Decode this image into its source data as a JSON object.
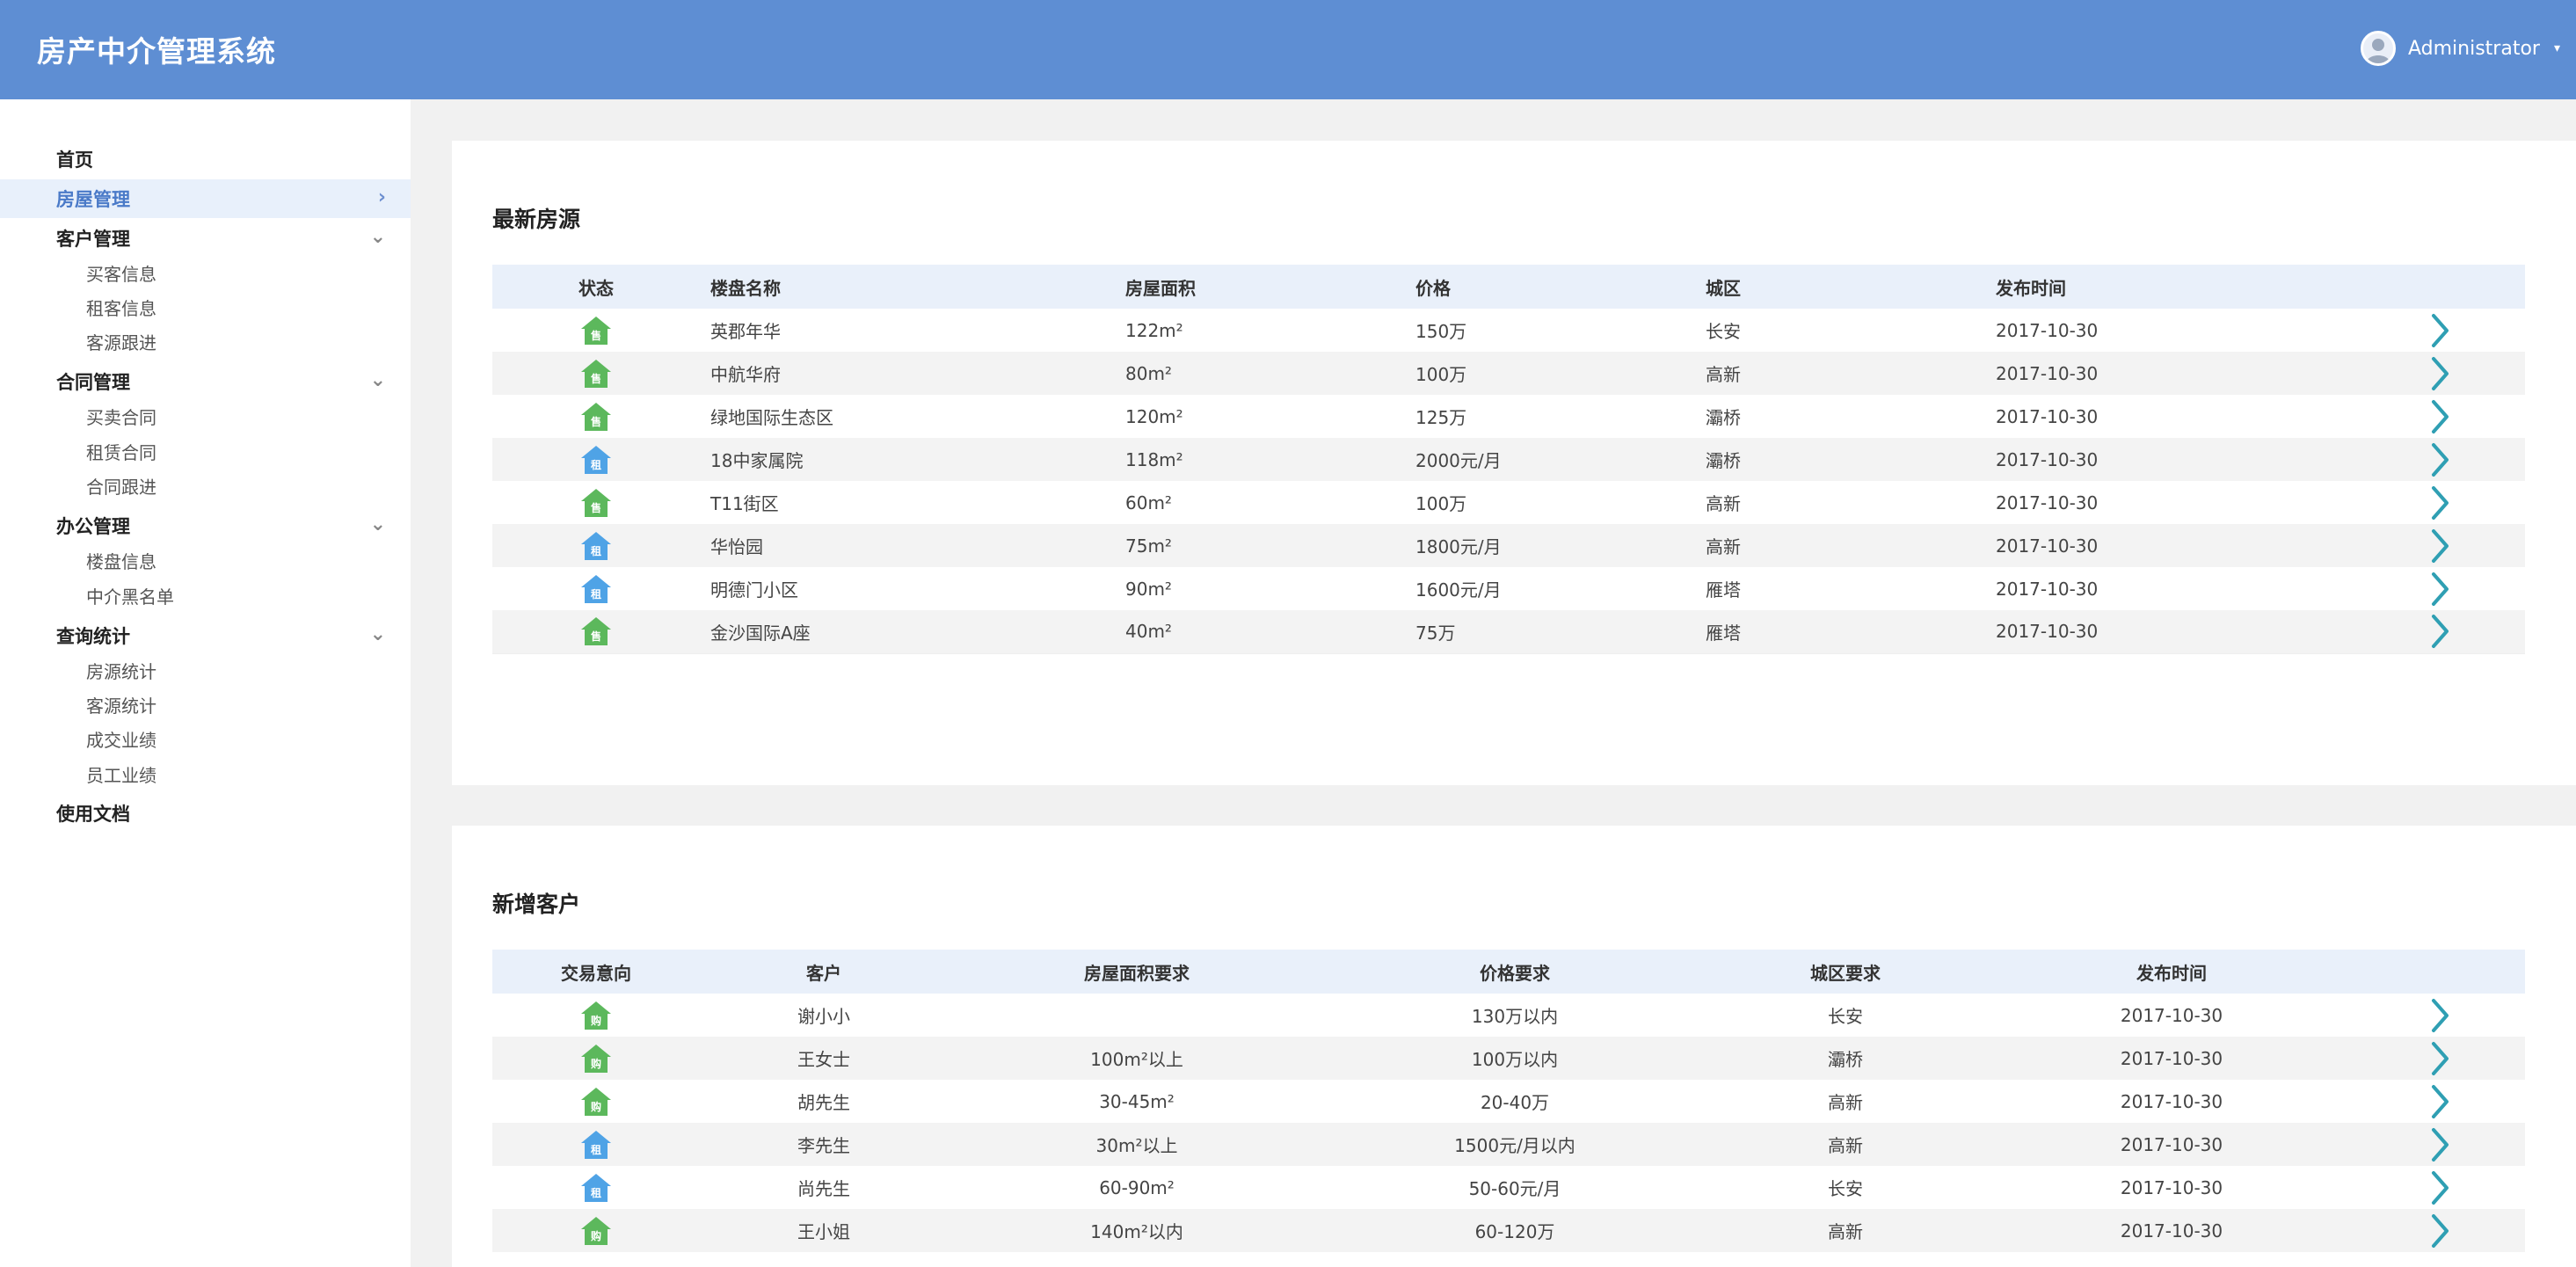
{
  "header": {
    "title": "房产中介管理系统",
    "user": "Administrator"
  },
  "sidebar": {
    "home": "首页",
    "house_mgmt": "房屋管理",
    "customer_mgmt": "客户管理",
    "customer_items": [
      "买客信息",
      "租客信息",
      "客源跟进"
    ],
    "contract_mgmt": "合同管理",
    "contract_items": [
      "买卖合同",
      "租赁合同",
      "合同跟进"
    ],
    "office_mgmt": "办公管理",
    "office_items": [
      "楼盘信息",
      "中介黑名单"
    ],
    "stats": "查询统计",
    "stats_items": [
      "房源统计",
      "客源统计",
      "成交业绩",
      "员工业绩"
    ],
    "docs": "使用文档"
  },
  "houses": {
    "title": "最新房源",
    "columns": [
      "状态",
      "楼盘名称",
      "房屋面积",
      "价格",
      "城区",
      "发布时间"
    ],
    "rows": [
      {
        "status": "售",
        "name": "英郡年华",
        "area": "122m²",
        "price": "150万",
        "district": "长安",
        "date": "2017-10-30"
      },
      {
        "status": "售",
        "name": "中航华府",
        "area": "80m²",
        "price": "100万",
        "district": "高新",
        "date": "2017-10-30"
      },
      {
        "status": "售",
        "name": "绿地国际生态区",
        "area": "120m²",
        "price": "125万",
        "district": "灞桥",
        "date": "2017-10-30"
      },
      {
        "status": "租",
        "name": "18中家属院",
        "area": "118m²",
        "price": "2000元/月",
        "district": "灞桥",
        "date": "2017-10-30"
      },
      {
        "status": "售",
        "name": "T11街区",
        "area": "60m²",
        "price": "100万",
        "district": "高新",
        "date": "2017-10-30"
      },
      {
        "status": "租",
        "name": "华怡园",
        "area": "75m²",
        "price": "1800元/月",
        "district": "高新",
        "date": "2017-10-30"
      },
      {
        "status": "租",
        "name": "明德门小区",
        "area": "90m²",
        "price": "1600元/月",
        "district": "雁塔",
        "date": "2017-10-30"
      },
      {
        "status": "售",
        "name": "金沙国际A座",
        "area": "40m²",
        "price": "75万",
        "district": "雁塔",
        "date": "2017-10-30"
      }
    ]
  },
  "customers": {
    "title": "新增客户",
    "columns": [
      "交易意向",
      "客户",
      "房屋面积要求",
      "价格要求",
      "城区要求",
      "发布时间"
    ],
    "rows": [
      {
        "intent": "购",
        "name": "谢小小",
        "area": "",
        "price": "130万以内",
        "district": "长安",
        "date": "2017-10-30"
      },
      {
        "intent": "购",
        "name": "王女士",
        "area": "100m²以上",
        "price": "100万以内",
        "district": "灞桥",
        "date": "2017-10-30"
      },
      {
        "intent": "购",
        "name": "胡先生",
        "area": "30-45m²",
        "price": "20-40万",
        "district": "高新",
        "date": "2017-10-30"
      },
      {
        "intent": "租",
        "name": "李先生",
        "area": "30m²以上",
        "price": "1500元/月以内",
        "district": "高新",
        "date": "2017-10-30"
      },
      {
        "intent": "租",
        "name": "尚先生",
        "area": "60-90m²",
        "price": "50-60元/月",
        "district": "长安",
        "date": "2017-10-30"
      },
      {
        "intent": "购",
        "name": "王小姐",
        "area": "140m²以内",
        "price": "60-120万",
        "district": "高新",
        "date": "2017-10-30"
      }
    ]
  },
  "colors": {
    "header": "#5e8ed3",
    "sell": "#5cb85c",
    "rent": "#4fa3e6",
    "arrow": "#2f9fb3"
  }
}
